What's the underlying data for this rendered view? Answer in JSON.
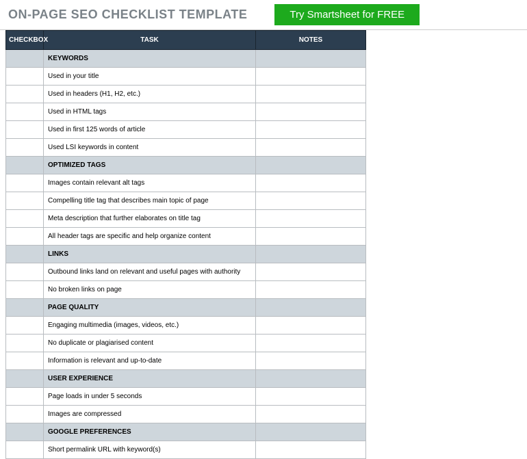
{
  "header": {
    "title": "ON-PAGE SEO CHECKLIST TEMPLATE",
    "cta": "Try Smartsheet for FREE"
  },
  "columns": {
    "checkbox": "CHECKBOX",
    "task": "TASK",
    "notes": "NOTES"
  },
  "sections": [
    {
      "name": "KEYWORDS",
      "rows": [
        {
          "task": "Used in your title",
          "notes": ""
        },
        {
          "task": "Used in headers (H1, H2, etc.)",
          "notes": ""
        },
        {
          "task": "Used in HTML tags",
          "notes": ""
        },
        {
          "task": "Used in first 125 words of article",
          "notes": ""
        },
        {
          "task": "Used LSI keywords in content",
          "notes": ""
        }
      ]
    },
    {
      "name": "OPTIMIZED TAGS",
      "rows": [
        {
          "task": "Images contain relevant alt tags",
          "notes": ""
        },
        {
          "task": "Compelling title tag that describes main topic of page",
          "notes": ""
        },
        {
          "task": "Meta description that further elaborates on title tag",
          "notes": ""
        },
        {
          "task": "All header tags are specific and help organize content",
          "notes": ""
        }
      ]
    },
    {
      "name": "LINKS",
      "rows": [
        {
          "task": "Outbound links land on relevant and useful pages with authority",
          "notes": ""
        },
        {
          "task": "No broken links on page",
          "notes": ""
        }
      ]
    },
    {
      "name": "PAGE QUALITY",
      "rows": [
        {
          "task": "Engaging multimedia (images, videos, etc.)",
          "notes": ""
        },
        {
          "task": "No duplicate or plagiarised content",
          "notes": ""
        },
        {
          "task": "Information is relevant and up-to-date",
          "notes": ""
        }
      ]
    },
    {
      "name": "USER EXPERIENCE",
      "rows": [
        {
          "task": "Page loads in under 5 seconds",
          "notes": ""
        },
        {
          "task": "Images are compressed",
          "notes": ""
        }
      ]
    },
    {
      "name": "GOOGLE PREFERENCES",
      "rows": [
        {
          "task": "Short permalink URL with keyword(s)",
          "notes": ""
        }
      ]
    }
  ]
}
